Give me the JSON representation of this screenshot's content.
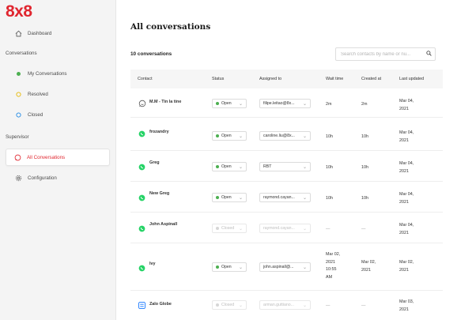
{
  "app": {
    "logo": "8x8"
  },
  "sidebar": {
    "dashboard": "Dashboard",
    "conversations_section": "Conversations",
    "my_conversations": "My Conversations",
    "resolved": "Resolved",
    "closed": "Closed",
    "supervisor_section": "Supervisor",
    "all_conversations": "All Conversations",
    "configuration": "Configuration"
  },
  "main": {
    "title": "All conversations",
    "count": "10 conversations",
    "search_placeholder": "Search contacts by name or nu..."
  },
  "table": {
    "headers": [
      "Contact",
      "Status",
      "Assigned to",
      "Wait time",
      "Created at",
      "Last updated"
    ],
    "rows": [
      {
        "icon": "chat-icon",
        "name": "M.M - Tin la tine",
        "status": "Open",
        "assignee": "filipe.leitao@8x...",
        "wait": "2m",
        "created": "2m",
        "updated": [
          "Mar 04,",
          "2021"
        ],
        "disabled": false
      },
      {
        "icon": "whatsapp-icon",
        "name": "frozandry",
        "status": "Open",
        "assignee": "caroline.liu@8x...",
        "wait": "10h",
        "created": "10h",
        "updated": [
          "Mar 04,",
          "2021"
        ],
        "disabled": false
      },
      {
        "icon": "whatsapp-icon",
        "name": "Greg",
        "status": "Open",
        "assignee": "RBT",
        "wait": "10h",
        "created": "10h",
        "updated": [
          "Mar 04,",
          "2021"
        ],
        "disabled": false
      },
      {
        "icon": "whatsapp-icon",
        "name": "New Greg",
        "status": "Open",
        "assignee": "raymond.cayan...",
        "wait": "10h",
        "created": "10h",
        "updated": [
          "Mar 04,",
          "2021"
        ],
        "disabled": false
      },
      {
        "icon": "whatsapp-icon",
        "name": "John Aspinall",
        "status": "Closed",
        "assignee": "raymond.cayan...",
        "wait": "—",
        "created": "—",
        "updated": [
          "Mar 04,",
          "2021"
        ],
        "disabled": true
      },
      {
        "icon": "whatsapp-icon",
        "name": "Ivy",
        "status": "Open",
        "assignee": "john.aspinall@...",
        "wait": [
          "Mar 02,",
          "2021",
          "10:55",
          "AM"
        ],
        "created": [
          "Mar 02,",
          "2021"
        ],
        "updated": [
          "Mar 02,",
          "2021"
        ],
        "disabled": false
      },
      {
        "icon": "zalo-icon",
        "name": "Zalo Globe",
        "status": "Closed",
        "assignee": "arman.guttiano...",
        "wait": "—",
        "created": "—",
        "updated": [
          "Mar 03,",
          "2021"
        ],
        "disabled": true
      }
    ]
  },
  "colors": {
    "brand": "#e0262f",
    "open": "#4caf50",
    "closed": "#cfcfcf",
    "whatsapp": "#25d366",
    "zalo": "#1677ff"
  }
}
